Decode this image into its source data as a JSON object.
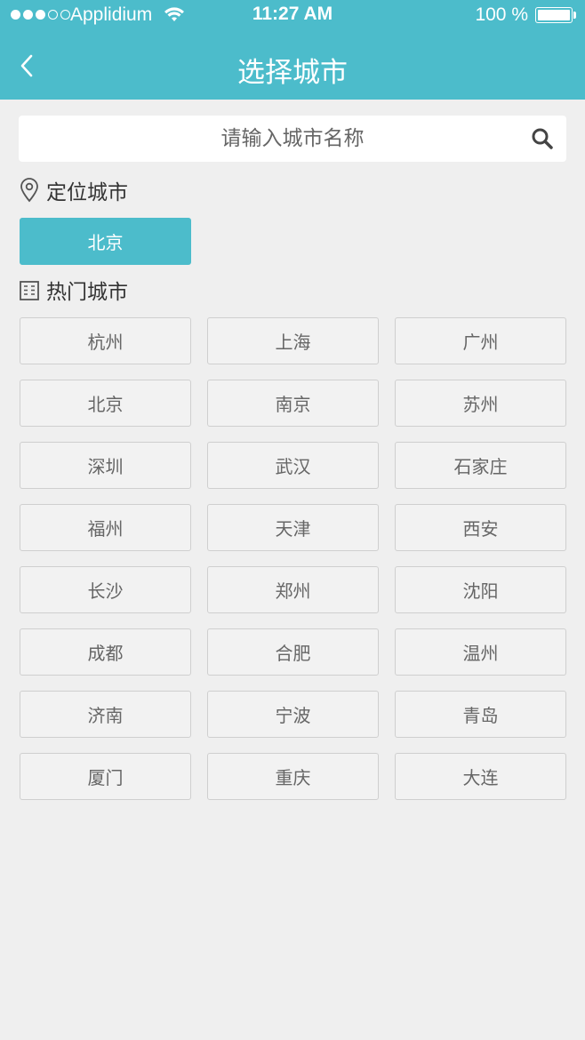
{
  "status_bar": {
    "carrier": "Applidium",
    "time": "11:27 AM",
    "battery": "100 %"
  },
  "nav": {
    "title": "选择城市",
    "back_icon": "chevron-left-icon"
  },
  "search": {
    "placeholder": "请输入城市名称",
    "icon": "search-icon"
  },
  "location_section": {
    "title": "定位城市",
    "icon": "location-pin-icon",
    "current_city": "北京"
  },
  "hot_section": {
    "title": "热门城市",
    "icon": "building-icon",
    "cities": [
      "杭州",
      "上海",
      "广州",
      "北京",
      "南京",
      "苏州",
      "深圳",
      "武汉",
      "石家庄",
      "福州",
      "天津",
      "西安",
      "长沙",
      "郑州",
      "沈阳",
      "成都",
      "合肥",
      "温州",
      "济南",
      "宁波",
      "青岛",
      "厦门",
      "重庆",
      "大连"
    ]
  },
  "colors": {
    "accent": "#4cbccb",
    "background": "#efefef"
  }
}
